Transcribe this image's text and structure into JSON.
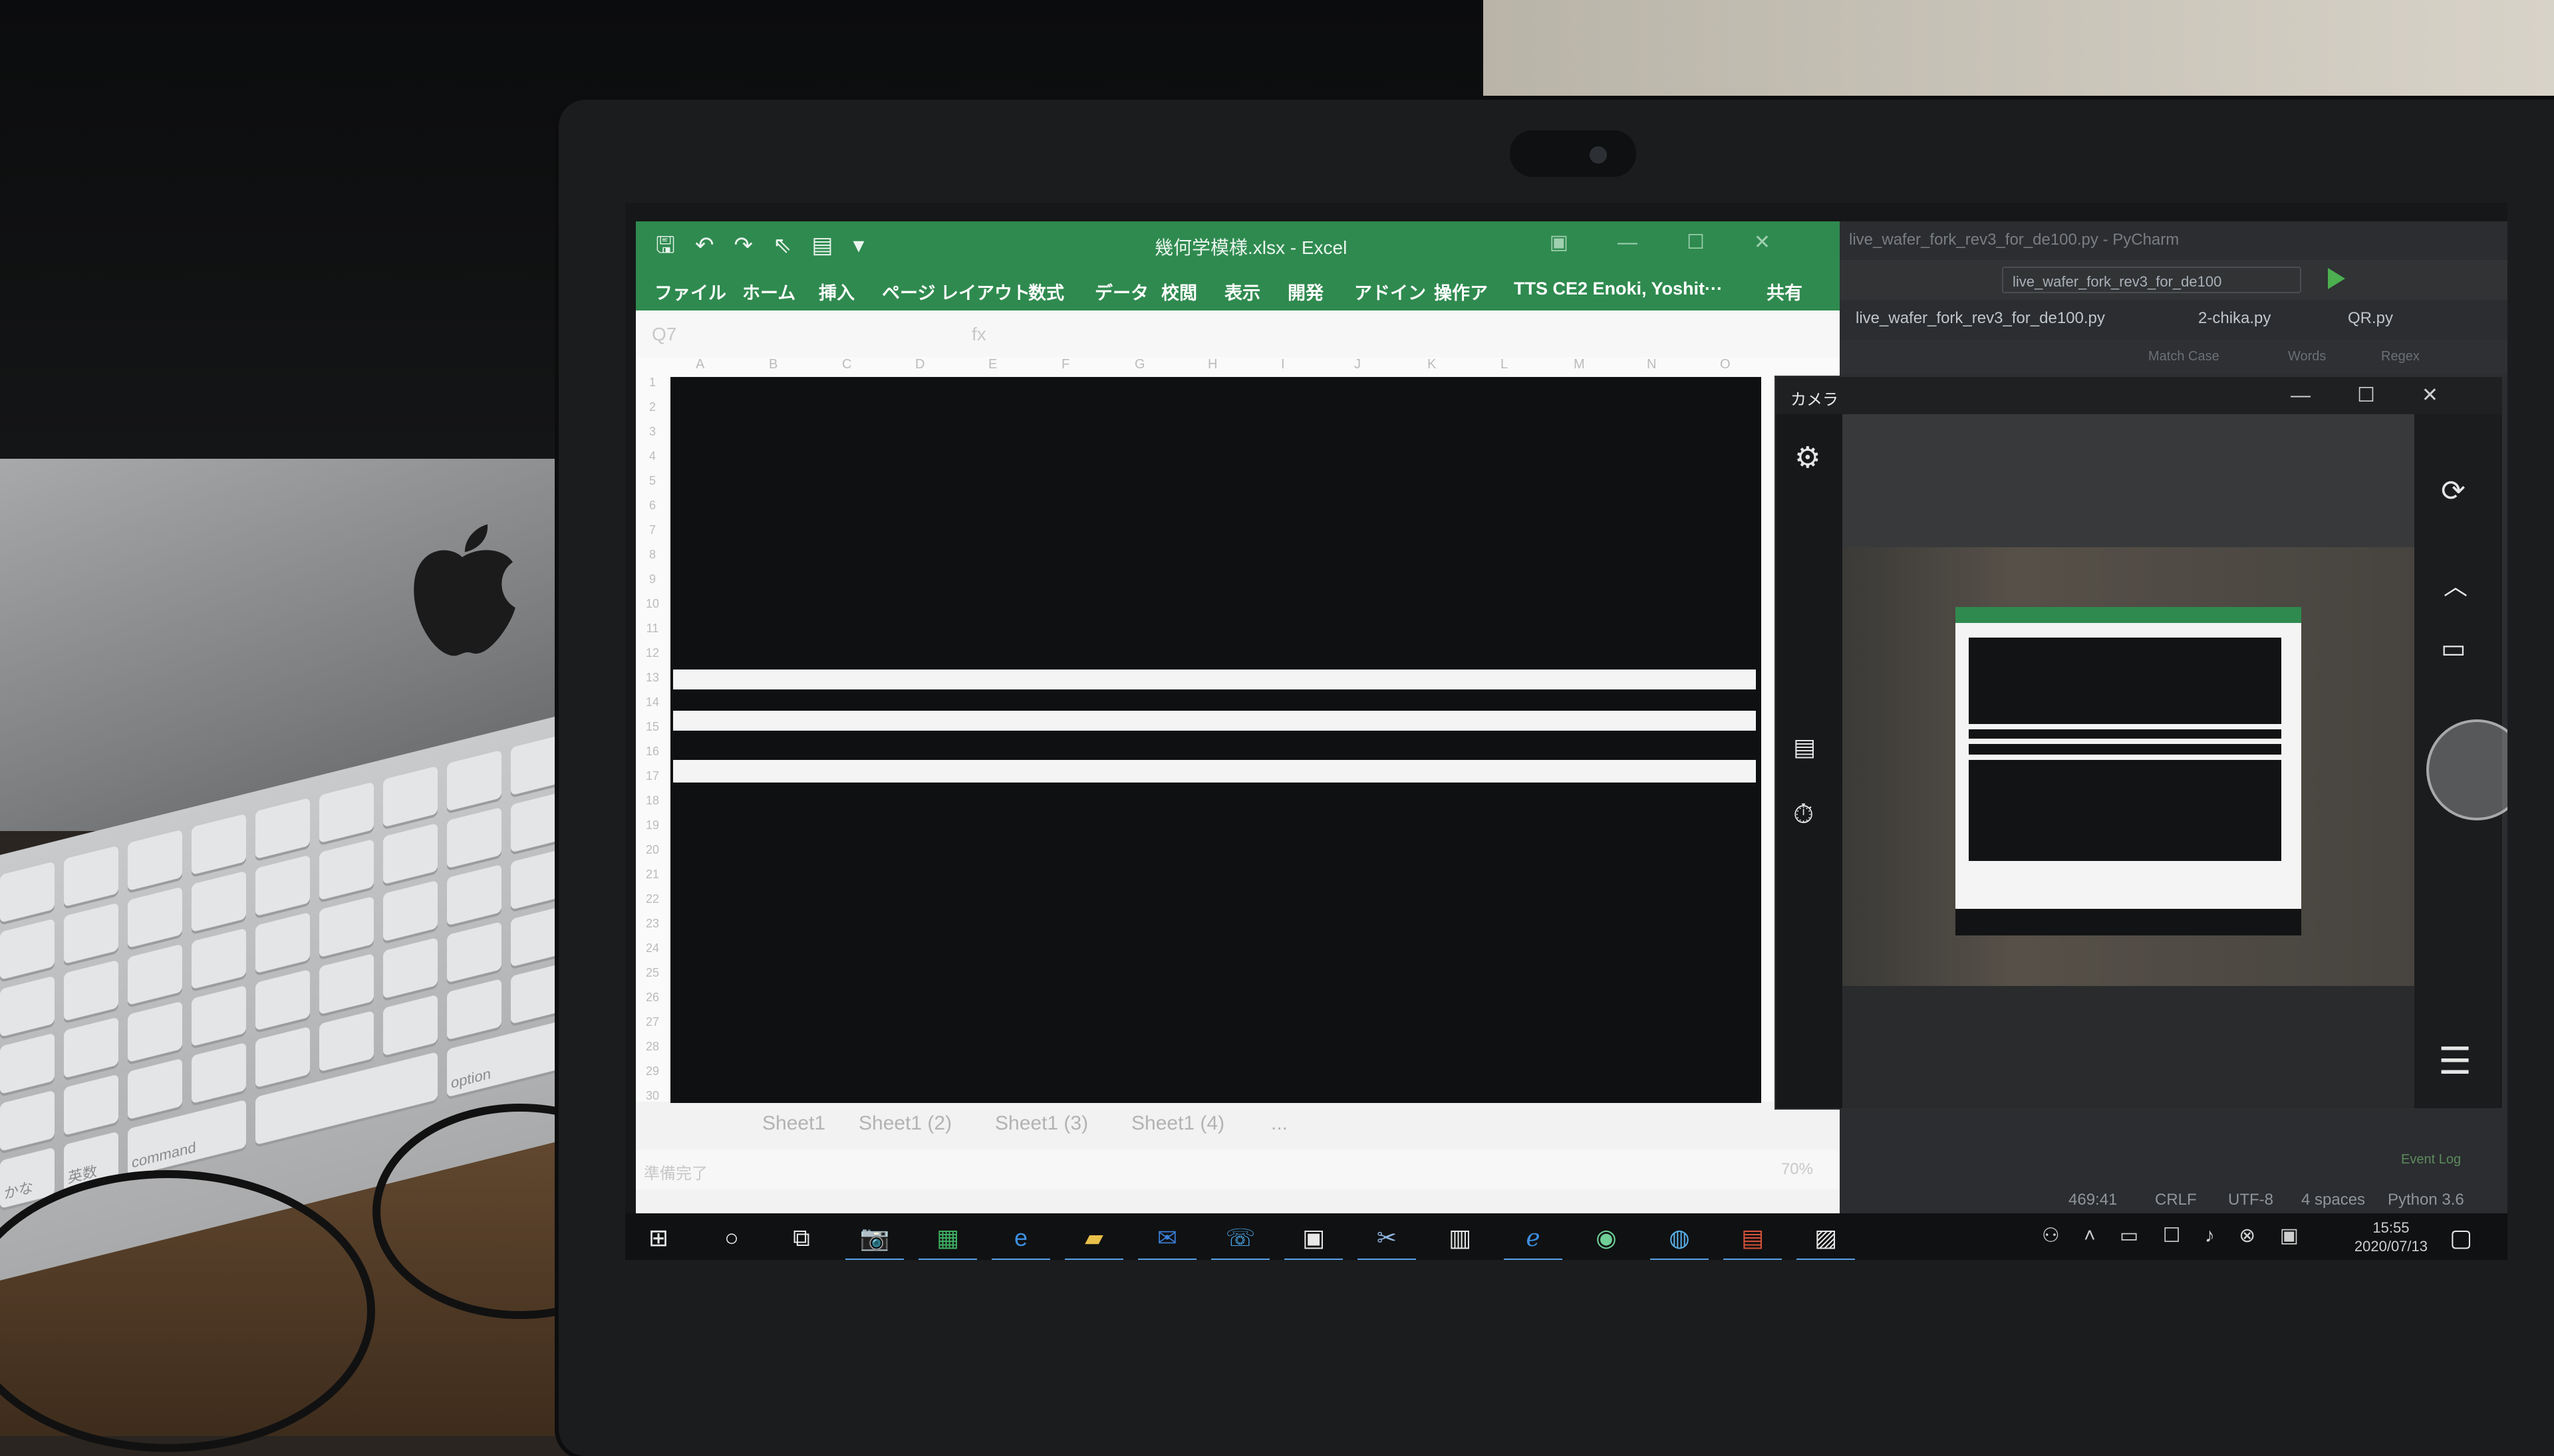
{
  "excel": {
    "title": "幾何学模様.xlsx - Excel",
    "ribbon": [
      "ファイル",
      "ホーム",
      "挿入",
      "ページ レイアウト",
      "数式",
      "データ",
      "校閲",
      "表示",
      "開発",
      "アドイン",
      "操作ア",
      "TTS CE2 Enoki, Yoshit···",
      "共有"
    ],
    "formula_name": "Q7",
    "formula_fx": "fx",
    "columns": [
      "A",
      "B",
      "C",
      "D",
      "E",
      "F",
      "G",
      "H",
      "I",
      "J",
      "K",
      "L",
      "M",
      "N",
      "O"
    ],
    "rows": [
      "1",
      "2",
      "3",
      "4",
      "5",
      "6",
      "7",
      "8",
      "9",
      "10",
      "11",
      "12",
      "13",
      "14",
      "15",
      "16",
      "17",
      "18",
      "19",
      "20",
      "21",
      "22",
      "23",
      "24",
      "25",
      "26",
      "27",
      "28",
      "29",
      "30"
    ],
    "sheets": [
      "Sheet1",
      "Sheet1 (2)",
      "Sheet1 (3)",
      "Sheet1 (4)",
      "..."
    ],
    "status_left": "準備完了",
    "zoom": "70%"
  },
  "pycharm": {
    "window_title": "live_wafer_fork_rev3_for_de100.py - PyCharm",
    "run_config": "live_wafer_fork_rev3_for_de100",
    "tabs": [
      "live_wafer_fork_rev3_for_de100.py",
      "2-chika.py",
      "QR.py"
    ],
    "find_options": [
      "Match Case",
      "Words",
      "Regex"
    ],
    "event_log": "Event Log",
    "status": [
      "469:41",
      "CRLF",
      "UTF-8",
      "4 spaces",
      "Python 3.6"
    ]
  },
  "camera": {
    "title": "カメラ"
  },
  "taskbar": {
    "time": "15:55",
    "date": "2020/07/13"
  },
  "keyboard": {
    "labels": [
      "command",
      "option",
      "かな",
      "英数"
    ]
  },
  "colors": {
    "excel_green": "#2f8a4f",
    "pycharm_dark": "#2b2d30",
    "taskbar": "#101112",
    "accent_blue": "#5aa0e6"
  }
}
